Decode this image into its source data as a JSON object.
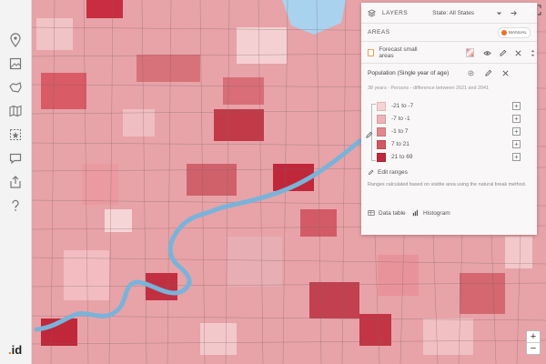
{
  "panel": {
    "layers_label": "LAYERS",
    "state_label": "State: All States",
    "areas_label": "AREAS",
    "manual_label": "MANUAL",
    "forecast_label": "Forecast small areas",
    "population_title": "Population (Single year of age)",
    "subtitle": "38 years - Persons - difference between 2021 and 2041",
    "legend": [
      {
        "label": "-21 to -7",
        "color": "#f7d3d6"
      },
      {
        "label": "-7 to -1",
        "color": "#efb3b8"
      },
      {
        "label": "-1 to 7",
        "color": "#e2878e"
      },
      {
        "label": "7 to 21",
        "color": "#d15761"
      },
      {
        "label": "21 to 69",
        "color": "#c0273a"
      }
    ],
    "edit_ranges_label": "Edit ranges",
    "note": "Ranges calculated based on visible area using the natural break method.",
    "data_table_label": "Data table",
    "histogram_label": "Histogram"
  },
  "branding": {
    "logo_prefix": ".",
    "logo_text": "id"
  },
  "zoom": {
    "plus": "+",
    "minus": "−"
  },
  "icons": {
    "sidebar": [
      "location-pin-icon",
      "image-layer-icon",
      "boundary-icon",
      "map-icon",
      "area-select-icon",
      "comment-icon",
      "share-icon",
      "help-icon"
    ],
    "panel": [
      "layers-icon",
      "dropdown-icon",
      "arrow-icon",
      "eye-icon",
      "pencil-icon",
      "close-icon",
      "drag-icon",
      "gear-icon",
      "edit-icon",
      "table-icon",
      "histogram-icon"
    ],
    "map": [
      "fullscreen-icon"
    ]
  },
  "colors": {
    "river": "#7ab3d9",
    "sea": "#a9d2ef",
    "accent": "#e8702a"
  }
}
